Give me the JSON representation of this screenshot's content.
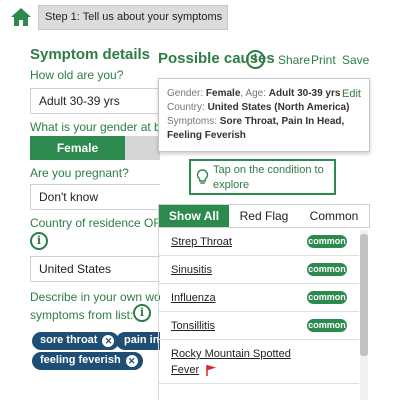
{
  "header": {
    "step_label": "Step 1: Tell us about your symptoms",
    "home_icon": "home-icon"
  },
  "form": {
    "section_title": "Symptom details",
    "age_question": "How old are you?",
    "age_value": "Adult 30-39 yrs",
    "gender_question": "What is your gender at birth?",
    "gender_value": "Female",
    "pregnant_question": "Are you pregnant?",
    "pregnant_value": "Don't know",
    "country_question": "Country of residence OR recent travel",
    "country_value": "United States",
    "describe_question": "Describe in your own words or select",
    "describe_question_2": "symptoms from list:",
    "chips": [
      "sore throat",
      "pain in head",
      "feeling feverish"
    ]
  },
  "causes": {
    "title": "Possible causes",
    "share_label": "Share",
    "print_label": "Print",
    "save_label": "Save"
  },
  "summary": {
    "gender_label": "Gender:",
    "gender_value": "Female",
    "age_label": ", Age:",
    "age_value": "Adult 30-39 yrs",
    "country_label": "Country:",
    "country_value": "United States (North America)",
    "symptoms_label": "Symptoms:",
    "symptoms_value": "Sore Throat, Pain In Head, Feeling Feverish",
    "edit_label": "Edit"
  },
  "tip": {
    "text": "Tap on the condition to explore"
  },
  "tabs": [
    "Show All",
    "Red Flag",
    "Common"
  ],
  "conditions": [
    {
      "name": "Strep Throat",
      "badge": "common"
    },
    {
      "name": "Sinusitis",
      "badge": "common"
    },
    {
      "name": "Influenza",
      "badge": "common"
    },
    {
      "name": "Tonsillitis",
      "badge": "common"
    },
    {
      "name": "Rocky Mountain Spotted Fever",
      "name_line1": "Rocky Mountain Spotted",
      "name_line2": "Fever",
      "flag": "red-flag-icon"
    }
  ],
  "colors": {
    "brand_green": "#2d8a4e",
    "chip_navy": "#1e4e74",
    "flag_red": "#e0242f"
  }
}
